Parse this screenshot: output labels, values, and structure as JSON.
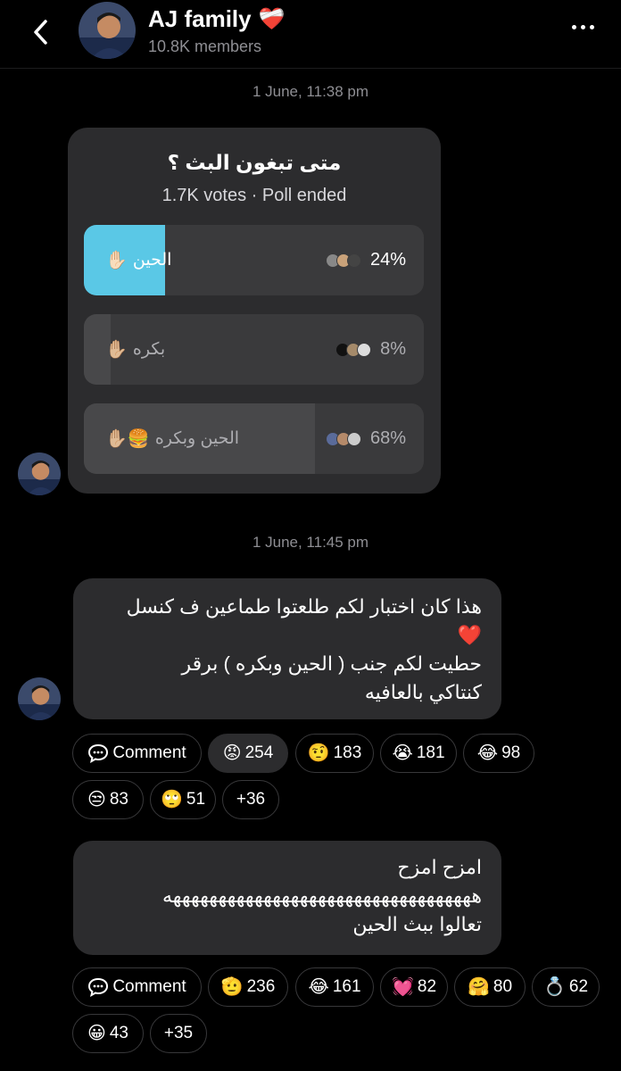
{
  "header": {
    "title": "AJ family",
    "title_emoji": "❤️‍🩹",
    "members": "10.8K members"
  },
  "messages": [
    {
      "timestamp": "1 June, 11:38 pm",
      "poll": {
        "question": "متى تبغون البث ؟",
        "meta": "1.7K votes · Poll ended",
        "options": [
          {
            "label": "الحين",
            "emoji": "✋🏻",
            "percent": "24%",
            "fill": 0.24,
            "fill_color": "#5ac8e6"
          },
          {
            "label": "بكره",
            "emoji": "✋🏼",
            "percent": "8%",
            "fill": 0.08,
            "fill_color": "#48484a"
          },
          {
            "label": "الحين وبكره",
            "emoji": "✋🏼🍔",
            "percent": "68%",
            "fill": 0.68,
            "fill_color": "#48484a"
          }
        ]
      }
    },
    {
      "timestamp": "1 June, 11:45 pm",
      "lines": [
        "هذا كان اختبار لكم طلعتوا طماعين ف كنسل",
        "❤️",
        "حطيت لكم جنب ( الحين وبكره ) برقر",
        "كنتاكي بالعافيه"
      ],
      "comment_label": "Comment",
      "reactions": [
        {
          "emoji": "😡",
          "count": "254",
          "active": true
        },
        {
          "emoji": "🤨",
          "count": "183"
        },
        {
          "emoji": "😭",
          "count": "181"
        },
        {
          "emoji": "😂",
          "count": "98"
        },
        {
          "emoji": "😒",
          "count": "83"
        },
        {
          "emoji": "🙄",
          "count": "51"
        },
        {
          "emoji": "",
          "count": "+36"
        }
      ]
    },
    {
      "lines": [
        "امزح امزح",
        "ههههههههههههههههههههههههههههههههههه",
        "تعالوا ببث الحين"
      ],
      "comment_label": "Comment",
      "reactions": [
        {
          "emoji": "🫡",
          "count": "236"
        },
        {
          "emoji": "😂",
          "count": "161"
        },
        {
          "emoji": "💓",
          "count": "82"
        },
        {
          "emoji": "🤗",
          "count": "80"
        },
        {
          "emoji": "💍",
          "count": "62"
        },
        {
          "emoji": "😀",
          "count": "43"
        },
        {
          "emoji": "",
          "count": "+35"
        }
      ]
    }
  ]
}
